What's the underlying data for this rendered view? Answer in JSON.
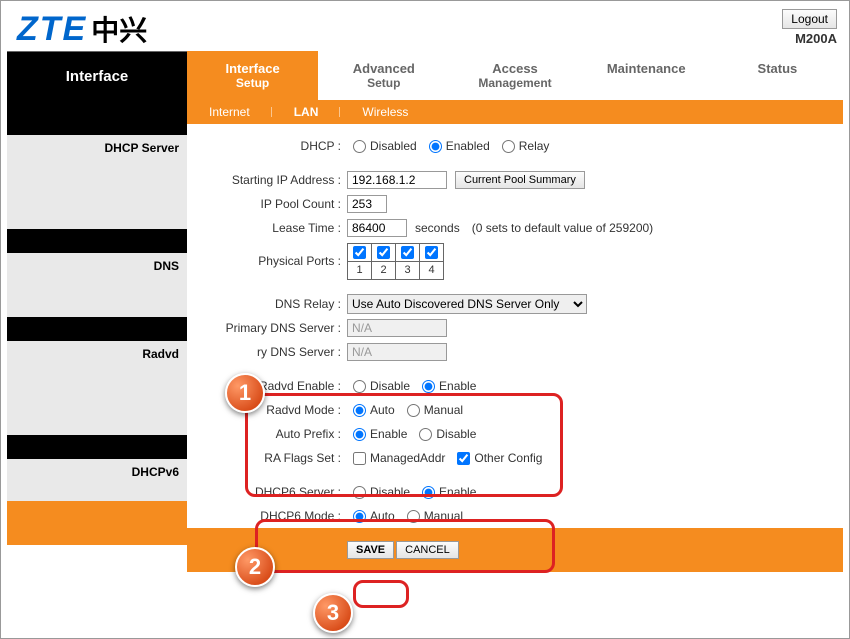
{
  "header": {
    "logo_zte": "ZTE",
    "logo_cn": "中兴",
    "logout": "Logout",
    "model": "M200A"
  },
  "sidebar": {
    "title": "Interface",
    "sections": [
      "DHCP Server",
      "DNS",
      "Radvd",
      "DHCPv6"
    ]
  },
  "tabs_main": [
    {
      "line1": "Interface",
      "line2": "Setup",
      "active": true
    },
    {
      "line1": "Advanced",
      "line2": "Setup",
      "active": false
    },
    {
      "line1": "Access",
      "line2": "Management",
      "active": false
    },
    {
      "line1": "Maintenance",
      "line2": "",
      "active": false
    },
    {
      "line1": "Status",
      "line2": "",
      "active": false
    }
  ],
  "tabs_sub": [
    {
      "label": "Internet",
      "active": false
    },
    {
      "label": "LAN",
      "active": true
    },
    {
      "label": "Wireless",
      "active": false
    }
  ],
  "dhcp": {
    "label": "DHCP :",
    "options": [
      "Disabled",
      "Enabled",
      "Relay"
    ],
    "selected": "Enabled"
  },
  "dhcp_server": {
    "starting_ip_label": "Starting IP Address :",
    "starting_ip": "192.168.1.2",
    "pool_summary_btn": "Current Pool Summary",
    "count_label": "IP Pool Count :",
    "count": "253",
    "lease_label": "Lease Time :",
    "lease": "86400",
    "lease_unit": "seconds",
    "lease_note": "(0 sets to default value of 259200)",
    "ports_label": "Physical Ports :",
    "ports": [
      "1",
      "2",
      "3",
      "4"
    ],
    "ports_checked": [
      true,
      true,
      true,
      true
    ]
  },
  "dns": {
    "relay_label": "DNS Relay :",
    "relay_value": "Use Auto Discovered DNS Server Only",
    "primary_label": "Primary DNS Server :",
    "primary_value": "N/A",
    "secondary_label": "ry DNS Server :",
    "secondary_value": "N/A"
  },
  "radvd": {
    "enable_label": "Radvd Enable :",
    "enable_opts": [
      "Disable",
      "Enable"
    ],
    "enable_sel": "Enable",
    "mode_label": "Radvd Mode :",
    "mode_opts": [
      "Auto",
      "Manual"
    ],
    "mode_sel": "Auto",
    "prefix_label": "Auto Prefix :",
    "prefix_opts": [
      "Enable",
      "Disable"
    ],
    "prefix_sel": "Enable",
    "flags_label": "RA Flags Set :",
    "flag1": "ManagedAddr",
    "flag1_checked": false,
    "flag2": "Other Config",
    "flag2_checked": true
  },
  "dhcpv6": {
    "server_label": "DHCP6 Server :",
    "server_opts": [
      "Disable",
      "Enable"
    ],
    "server_sel": "Enable",
    "mode_label": "DHCP6 Mode :",
    "mode_opts": [
      "Auto",
      "Manual"
    ],
    "mode_sel": "Auto"
  },
  "footer": {
    "save": "SAVE",
    "cancel": "CANCEL"
  },
  "callouts": [
    "1",
    "2",
    "3"
  ]
}
